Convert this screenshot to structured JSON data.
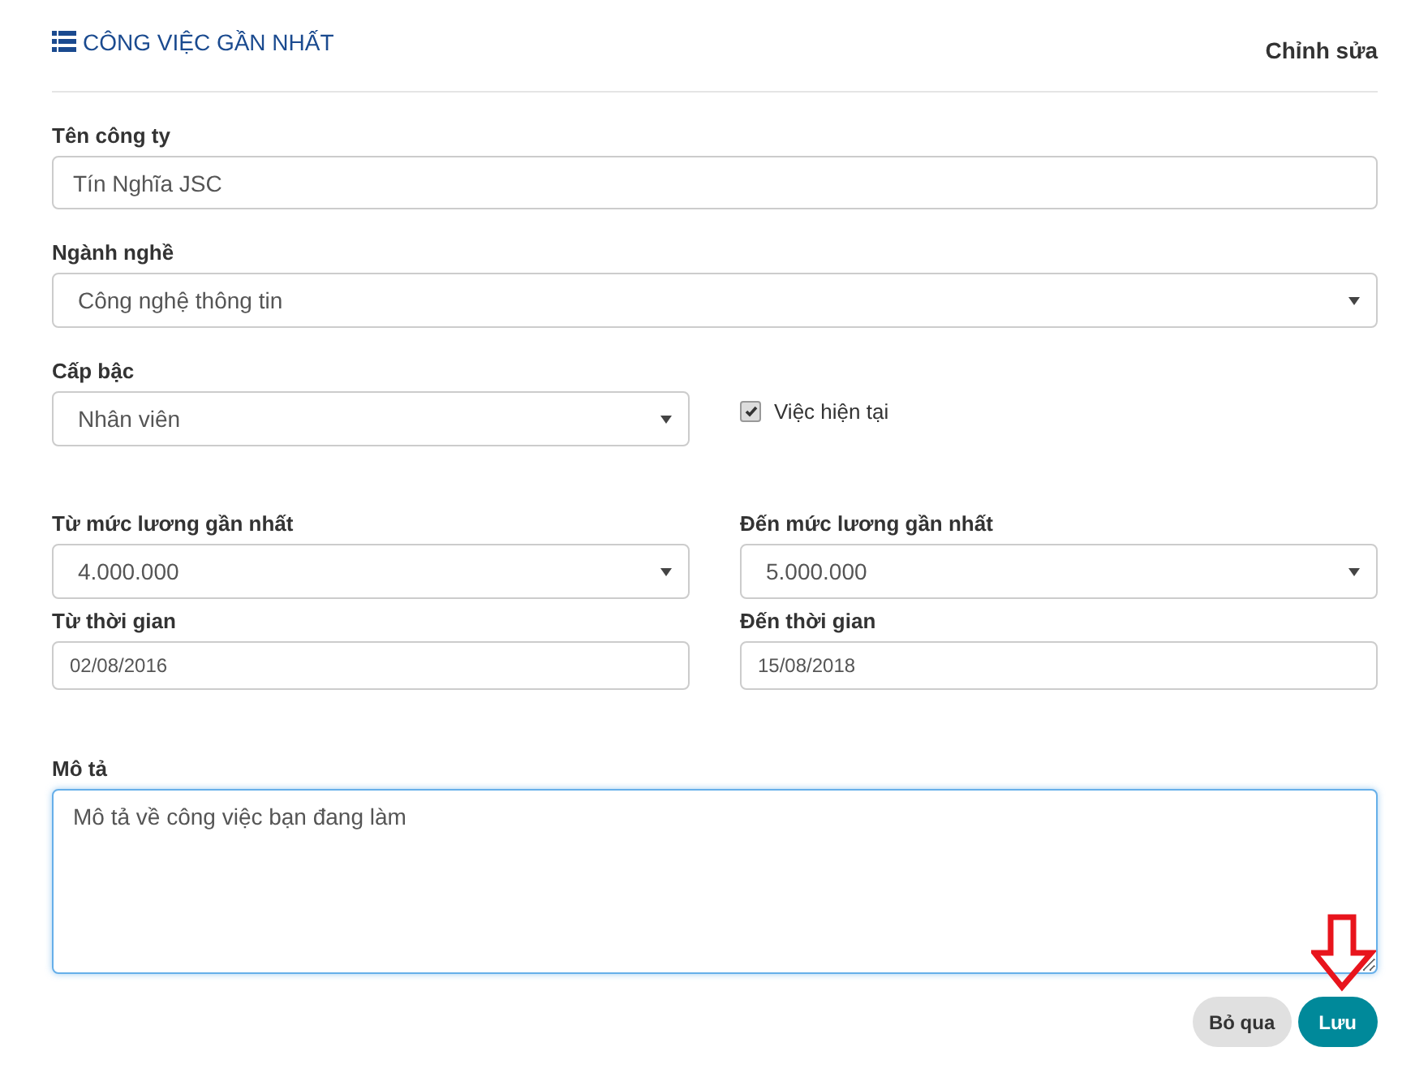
{
  "header": {
    "title": "CÔNG VIỆC GẦN NHẤT",
    "action": "Chỉnh sửa"
  },
  "company": {
    "label": "Tên công ty",
    "value": "Tín Nghĩa JSC"
  },
  "industry": {
    "label": "Ngành nghề",
    "value": "Công nghệ thông tin"
  },
  "level": {
    "label": "Cấp bậc",
    "value": "Nhân viên"
  },
  "current_job": {
    "label": "Việc hiện tại",
    "checked": true
  },
  "salary_from": {
    "label": "Từ mức lương gần nhất",
    "value": "4.000.000"
  },
  "salary_to": {
    "label": "Đến mức lương gần nhất",
    "value": "5.000.000"
  },
  "date_from": {
    "label": "Từ thời gian",
    "value": "02/08/2016"
  },
  "date_to": {
    "label": "Đến thời gian",
    "value": "15/08/2018"
  },
  "description": {
    "label": "Mô tả",
    "value": "Mô tả về công việc bạn đang làm",
    "focused": true
  },
  "buttons": [
    {
      "label": "Bỏ qua",
      "kind": "secondary"
    },
    {
      "label": "Lưu",
      "kind": "primary"
    }
  ]
}
